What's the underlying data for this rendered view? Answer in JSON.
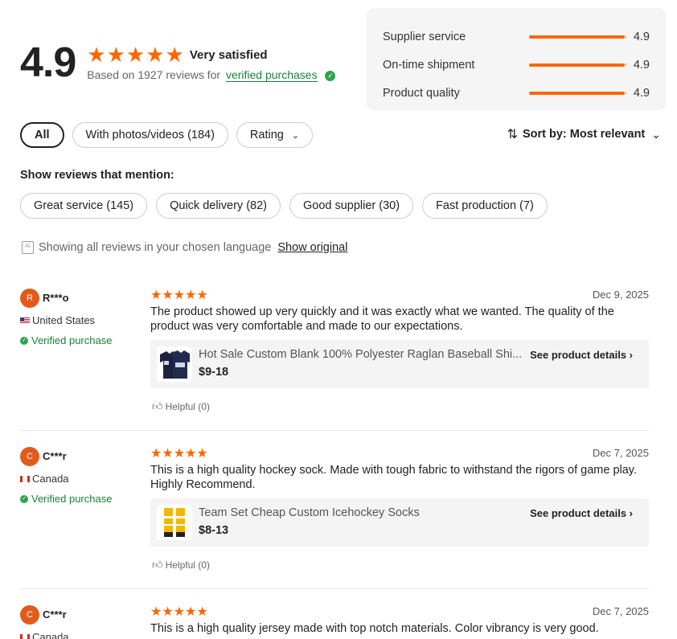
{
  "summary": {
    "rating": "4.9",
    "star_count": 5,
    "label": "Very satisfied",
    "based_on": "Based on 1927 reviews for",
    "verified_link": "verified purchases"
  },
  "metrics": [
    {
      "name": "Supplier service",
      "value": "4.9",
      "score": 4.9
    },
    {
      "name": "On-time shipment",
      "value": "4.9",
      "score": 4.9
    },
    {
      "name": "Product quality",
      "value": "4.9",
      "score": 4.9
    }
  ],
  "filters": {
    "all": "All",
    "photos": "With photos/videos (184)",
    "rating": "Rating"
  },
  "sort": {
    "label": "Sort by: Most relevant"
  },
  "mentions": {
    "title": "Show reviews that mention:",
    "tags": [
      "Great service (145)",
      "Quick delivery (82)",
      "Good supplier (30)",
      "Fast production (7)"
    ]
  },
  "language": {
    "notice": "Showing all reviews in your chosen language",
    "show_original": "Show original"
  },
  "reviews": [
    {
      "initial": "R",
      "name": "R***o",
      "country": "United States",
      "verified": "Verified purchase",
      "stars": "★★★★★",
      "date": "Dec 9, 2025",
      "text": "The product showed up very quickly and it was exactly what we wanted. The quality of the product was very comfortable and made to our expectations.",
      "product_title": "Hot Sale Custom Blank 100% Polyester Raglan Baseball Shi...",
      "product_price": "$9-18",
      "product_link": "See product details",
      "helpful": "Helpful (0)"
    },
    {
      "initial": "C",
      "name": "C***r",
      "country": "Canada",
      "verified": "Verified purchase",
      "stars": "★★★★★",
      "date": "Dec 7, 2025",
      "text": "This is a high quality hockey sock.  Made with tough fabric to withstand the rigors of game play.  Highly Recommend.",
      "product_title": "Team Set Cheap Custom Icehockey Socks",
      "product_price": "$8-13",
      "product_link": "See product details",
      "helpful": "Helpful (0)"
    },
    {
      "initial": "C",
      "name": "C***r",
      "country": "Canada",
      "stars": "★★★★★",
      "date": "Dec 7, 2025",
      "text": "This is a high quality jersey made with top notch materials.  Color vibrancy is very good."
    }
  ],
  "colors": {
    "accent": "#ff6600",
    "verified": "#1a7f37",
    "avatar": "#e35b1a"
  }
}
